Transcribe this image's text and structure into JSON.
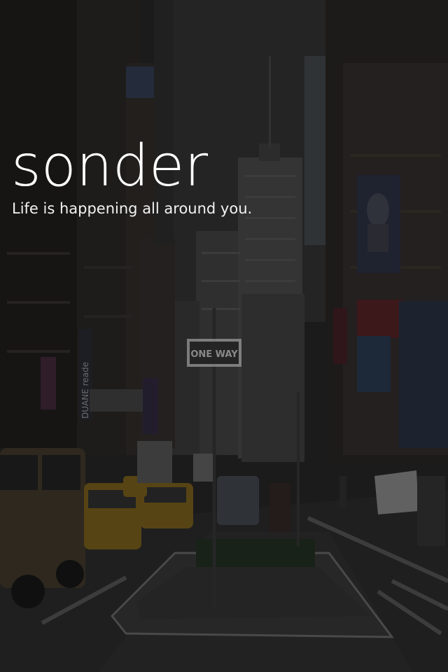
{
  "app": {
    "title": "sonder",
    "tagline": "Life is happening all around you."
  },
  "background": {
    "scene": "city-street-photo",
    "street_sign_text": "ONE WAY",
    "storefront_sign_text": "DUANE reade",
    "overlay_color": "#000000"
  }
}
